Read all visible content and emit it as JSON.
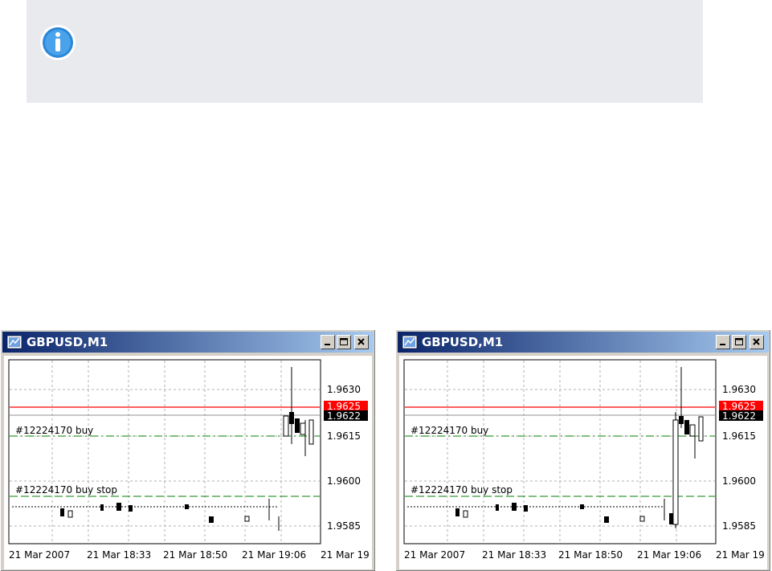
{
  "info_box": {
    "icon": "info-icon"
  },
  "windows": [
    {
      "title": "GBPUSD,M1",
      "buttons": [
        "minimize",
        "maximize",
        "close"
      ],
      "price_labels": [
        "1.9630",
        "1.9615",
        "1.9600",
        "1.9585"
      ],
      "ask_label": "1.9625",
      "bid_label": "1.9622",
      "time_labels": [
        "21 Mar 2007",
        "21 Mar 18:33",
        "21 Mar 18:50",
        "21 Mar 19:06",
        "21 Mar 19"
      ],
      "order_labels": [
        "#12224170 buy",
        "#12224170 buy stop"
      ],
      "colors": {
        "ask_line": "#ff0000",
        "order_line": "#008000",
        "bid_bg": "#000000"
      }
    },
    {
      "title": "GBPUSD,M1",
      "buttons": [
        "minimize",
        "maximize",
        "close"
      ],
      "price_labels": [
        "1.9630",
        "1.9615",
        "1.9600",
        "1.9585"
      ],
      "ask_label": "1.9625",
      "bid_label": "1.9622",
      "time_labels": [
        "21 Mar 2007",
        "21 Mar 18:33",
        "21 Mar 18:50",
        "21 Mar 19:06",
        "21 Mar 19"
      ],
      "order_labels": [
        "#12224170 buy",
        "#12224170 buy stop"
      ],
      "colors": {
        "ask_line": "#ff0000",
        "order_line": "#008000",
        "bid_bg": "#000000"
      }
    }
  ]
}
